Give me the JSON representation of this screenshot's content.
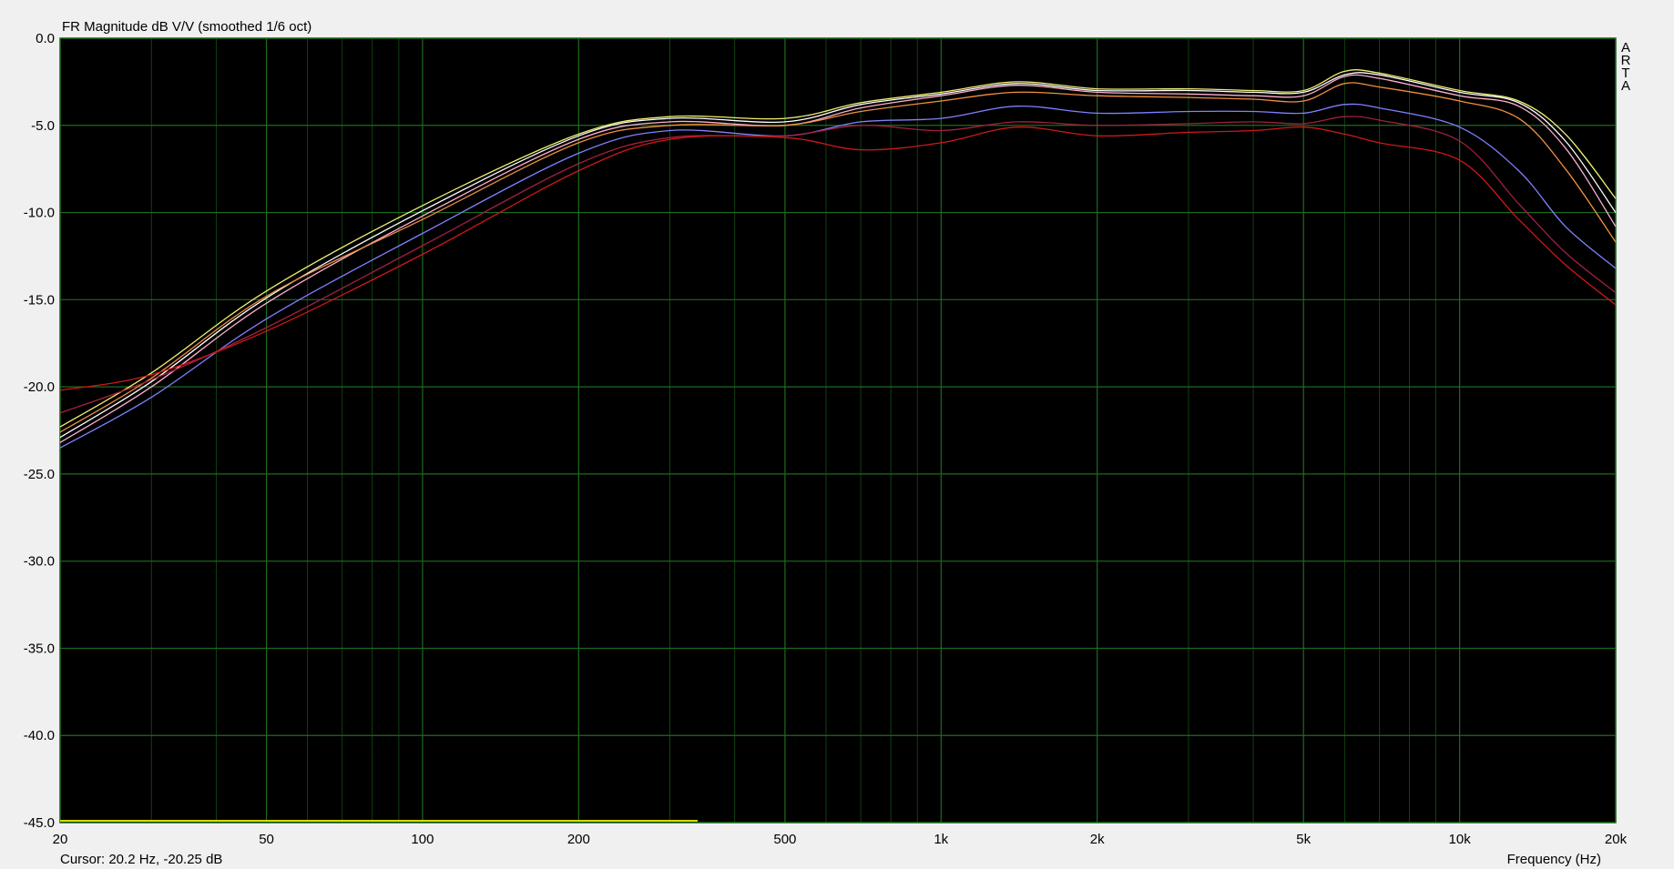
{
  "chart_data": {
    "type": "line",
    "title": "FR Magnitude dB V/V (smoothed 1/6 oct)",
    "xlabel": "Frequency (Hz)",
    "ylabel": "",
    "xscale": "log",
    "xlim": [
      20,
      20000
    ],
    "ylim": [
      -45,
      0
    ],
    "grid": true,
    "background": "#000000",
    "grid_color": "#1e6b1e",
    "x_tick_labels": [
      {
        "v": 20,
        "label": "20"
      },
      {
        "v": 50,
        "label": "50"
      },
      {
        "v": 100,
        "label": "100"
      },
      {
        "v": 200,
        "label": "200"
      },
      {
        "v": 500,
        "label": "500"
      },
      {
        "v": 1000,
        "label": "1k"
      },
      {
        "v": 2000,
        "label": "2k"
      },
      {
        "v": 5000,
        "label": "5k"
      },
      {
        "v": 10000,
        "label": "10k"
      },
      {
        "v": 20000,
        "label": "20k"
      }
    ],
    "y_tick_labels": [
      {
        "v": 0,
        "label": "0.0"
      },
      {
        "v": -5,
        "label": "-5.0"
      },
      {
        "v": -10,
        "label": "-10.0"
      },
      {
        "v": -15,
        "label": "-15.0"
      },
      {
        "v": -20,
        "label": "-20.0"
      },
      {
        "v": -25,
        "label": "-25.0"
      },
      {
        "v": -30,
        "label": "-30.0"
      },
      {
        "v": -35,
        "label": "-35.0"
      },
      {
        "v": -40,
        "label": "-40.0"
      },
      {
        "v": -45,
        "label": "-45.0"
      }
    ],
    "x": [
      20,
      30,
      50,
      100,
      200,
      300,
      500,
      700,
      1000,
      1400,
      2000,
      3000,
      4000,
      5000,
      6000,
      7000,
      10000,
      13000,
      16000,
      20000
    ],
    "series": [
      {
        "color": "#f0f070",
        "values": [
          -22.3,
          -19.2,
          -14.5,
          -9.6,
          -5.5,
          -4.5,
          -4.6,
          -3.7,
          -3.1,
          -2.5,
          -2.9,
          -2.9,
          -3.0,
          -3.0,
          -1.9,
          -2.0,
          -3.0,
          -3.6,
          -5.5,
          -9.2
        ]
      },
      {
        "color": "#ffffff",
        "values": [
          -22.9,
          -19.7,
          -14.9,
          -9.9,
          -5.6,
          -4.6,
          -4.8,
          -3.8,
          -3.2,
          -2.6,
          -3.0,
          -3.0,
          -3.1,
          -3.1,
          -2.1,
          -2.1,
          -3.1,
          -3.7,
          -5.9,
          -10.0
        ]
      },
      {
        "color": "#ffb0d0",
        "values": [
          -23.2,
          -20.0,
          -15.2,
          -10.2,
          -5.8,
          -4.8,
          -5.0,
          -4.0,
          -3.3,
          -2.7,
          -3.1,
          -3.2,
          -3.3,
          -3.3,
          -2.2,
          -2.3,
          -3.3,
          -3.9,
          -6.3,
          -10.8
        ]
      },
      {
        "color": "#f09040",
        "values": [
          -22.6,
          -19.5,
          -14.8,
          -10.4,
          -6.0,
          -5.0,
          -5.0,
          -4.2,
          -3.6,
          -3.1,
          -3.3,
          -3.4,
          -3.5,
          -3.6,
          -2.6,
          -2.8,
          -3.6,
          -4.6,
          -7.5,
          -11.7
        ]
      },
      {
        "color": "#8080ff",
        "values": [
          -23.5,
          -20.6,
          -16.1,
          -11.2,
          -6.6,
          -5.3,
          -5.6,
          -4.8,
          -4.6,
          -3.9,
          -4.3,
          -4.2,
          -4.2,
          -4.3,
          -3.8,
          -4.0,
          -5.1,
          -7.6,
          -10.8,
          -13.2
        ]
      },
      {
        "color": "#a02040",
        "values": [
          -21.5,
          -19.6,
          -16.6,
          -11.9,
          -7.2,
          -5.7,
          -5.6,
          -5.0,
          -5.3,
          -4.8,
          -5.0,
          -4.9,
          -4.8,
          -4.9,
          -4.5,
          -4.7,
          -5.9,
          -9.5,
          -12.3,
          -14.6
        ]
      },
      {
        "color": "#d01818",
        "values": [
          -20.2,
          -19.3,
          -16.8,
          -12.4,
          -7.6,
          -5.8,
          -5.7,
          -6.4,
          -6.0,
          -5.1,
          -5.6,
          -5.4,
          -5.3,
          -5.1,
          -5.5,
          -6.0,
          -7.0,
          -10.4,
          -13.0,
          -15.3
        ]
      }
    ]
  },
  "side_watermark": [
    "A",
    "R",
    "T",
    "A"
  ],
  "cursor_readout": "Cursor: 20.2 Hz, -20.25 dB"
}
